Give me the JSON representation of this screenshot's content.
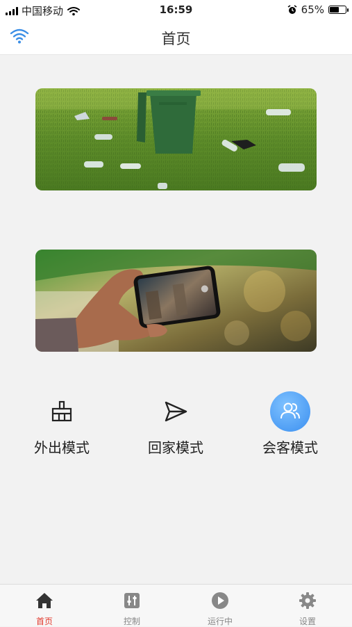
{
  "status_bar": {
    "carrier": "中国移动",
    "time": "16:59",
    "battery_percent": "65%",
    "battery_level": 0.65
  },
  "nav": {
    "title": "首页"
  },
  "modes": [
    {
      "label": "外出模式",
      "icon": "broom-icon",
      "active": false
    },
    {
      "label": "回家模式",
      "icon": "send-icon",
      "active": false
    },
    {
      "label": "会客模式",
      "icon": "users-icon",
      "active": true
    }
  ],
  "tabs": [
    {
      "label": "首页",
      "icon": "home-icon",
      "active": true
    },
    {
      "label": "控制",
      "icon": "sliders-icon",
      "active": false
    },
    {
      "label": "运行中",
      "icon": "play-icon",
      "active": false
    },
    {
      "label": "设置",
      "icon": "gear-icon",
      "active": false
    }
  ],
  "colors": {
    "accent": "#e23a2e",
    "mode_active": "#4a9bf2",
    "wifi": "#3a8ee6"
  }
}
